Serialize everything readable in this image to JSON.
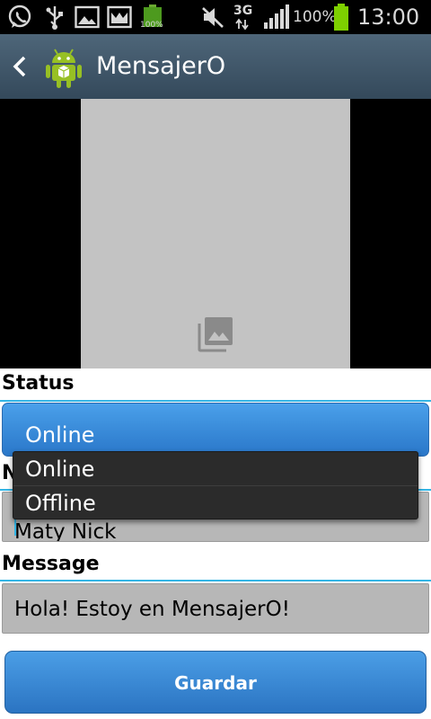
{
  "status_bar": {
    "battery_small_label": "100%",
    "network_type": "3G",
    "battery_percent": "100%",
    "time": "13:00",
    "icons": [
      "whatsapp-icon",
      "usb-icon",
      "image-icon",
      "gallery-icon",
      "battery-small-icon",
      "mute-icon",
      "signal-icon",
      "battery-icon"
    ]
  },
  "action_bar": {
    "title": "MensajerO",
    "icons": [
      "back-icon",
      "android-icon"
    ]
  },
  "image": {
    "icon": "gallery-icon",
    "placeholder_color": "#c3c3c3"
  },
  "form": {
    "status_label": "Status",
    "status_value": "Online",
    "nick_label_partial": "N",
    "nick_value": "Maty Nick",
    "message_label": "Message",
    "message_value": "Hola! Estoy en MensajerO!",
    "save_label": "Guardar"
  },
  "dropdown": {
    "options": [
      "Online",
      "Offline"
    ]
  },
  "colors": {
    "accent": "#33b5e5",
    "button": "#3a8ad8",
    "action_bar": "#425a6c"
  }
}
